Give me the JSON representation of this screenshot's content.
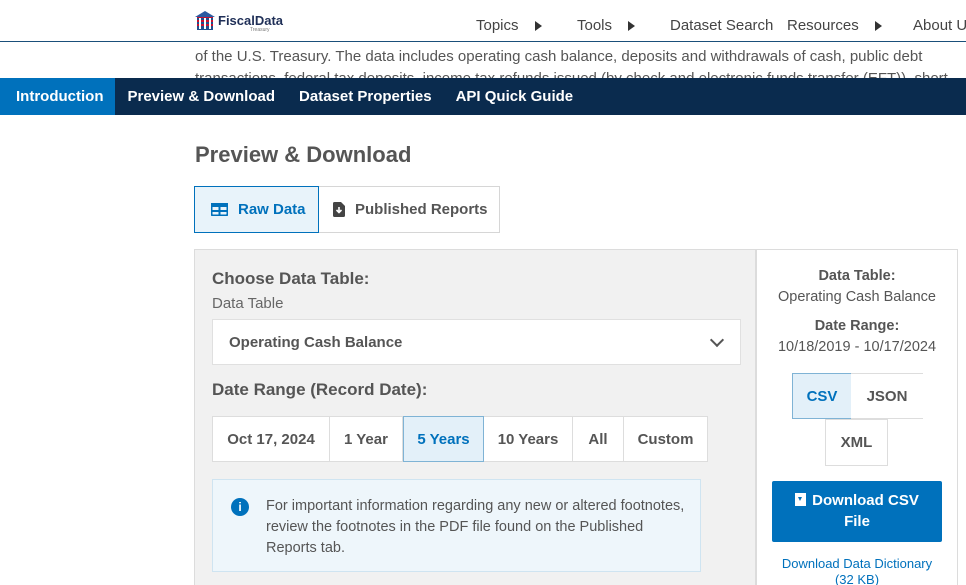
{
  "header": {
    "logo_text": "FiscalData",
    "logo_sub": "Treasury",
    "nav": [
      {
        "label": "Topics",
        "has_arrow": true
      },
      {
        "label": "Tools",
        "has_arrow": true
      },
      {
        "label": "Dataset Search",
        "has_arrow": false
      },
      {
        "label": "Resources",
        "has_arrow": true
      },
      {
        "label": "About Us",
        "has_arrow": false
      }
    ]
  },
  "intro_text": "of the U.S. Treasury. The data includes operating cash balance, deposits and withdrawals of cash, public debt transactions, federal tax deposits, income tax refunds issued (by check and electronic funds transfer (EFT)), short",
  "section_nav": {
    "items": [
      "Introduction",
      "Preview & Download",
      "Dataset Properties",
      "API Quick Guide"
    ],
    "active": "Introduction"
  },
  "preview": {
    "title": "Preview & Download",
    "toggle": {
      "raw": "Raw Data",
      "published": "Published Reports"
    },
    "choose_label": "Choose Data Table:",
    "table_label": "Data Table",
    "selected_table": "Operating Cash Balance",
    "date_range_label": "Date Range (Record Date):",
    "ranges": [
      "Oct 17, 2024",
      "1 Year",
      "5 Years",
      "10 Years",
      "All",
      "Custom"
    ],
    "selected_range": "5 Years",
    "info_text": "For important information regarding any new or altered footnotes, review the footnotes in the PDF file found on the Published Reports tab."
  },
  "side": {
    "table_heading": "Data Table:",
    "table_value": "Operating Cash Balance",
    "range_heading": "Date Range:",
    "range_value": "10/18/2019 - 10/17/2024",
    "formats": [
      "CSV",
      "JSON",
      "XML"
    ],
    "selected_format": "CSV",
    "download_label_line1": "Download CSV",
    "download_label_line2": "File",
    "dictionary_line1": "Download Data Dictionary",
    "dictionary_line2": "(32 KB)"
  },
  "colors": {
    "primary": "#0071bc",
    "nav_dark": "#0a2b4e",
    "selected_bg": "#e3f0f9"
  }
}
